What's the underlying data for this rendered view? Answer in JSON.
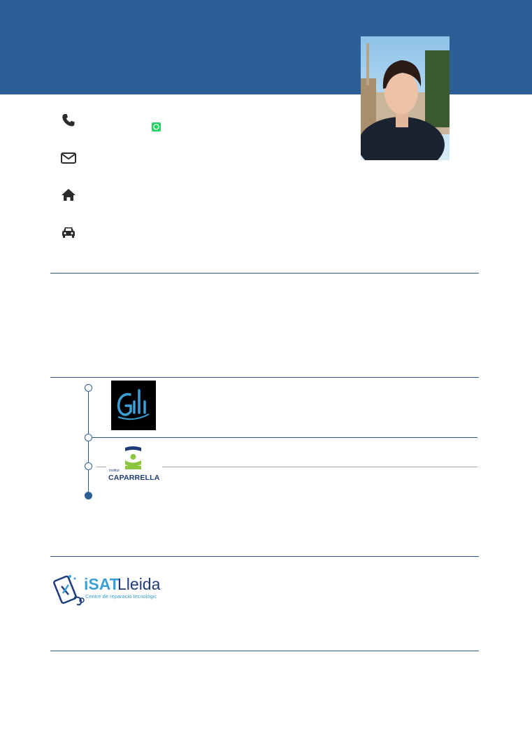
{
  "header": {
    "brand_color": "#2c5f98"
  },
  "contact": {
    "items": [
      {
        "icon": "phone-icon",
        "text": ""
      },
      {
        "icon": "envelope-icon",
        "text": ""
      },
      {
        "icon": "home-icon",
        "text": ""
      },
      {
        "icon": "car-icon",
        "text": ""
      }
    ],
    "whatsapp_icon": "whatsapp-icon"
  },
  "experience": {
    "logos": [
      "gili-logo",
      "caparrella-logo"
    ],
    "caparrella": {
      "small_text": "Institut",
      "name": "CAPARRELLA"
    }
  },
  "other": {
    "isat": {
      "name_prefix": "iSAT",
      "name_suffix": "Lleida",
      "tagline": "Centre de reparació tecnològic"
    }
  },
  "colors": {
    "primary": "#2c5f98",
    "whatsapp_green": "#25d366",
    "gili_blue": "#3aa0d8",
    "caparrella_green": "#8cc63f",
    "caparrella_navy": "#1d3c78"
  }
}
